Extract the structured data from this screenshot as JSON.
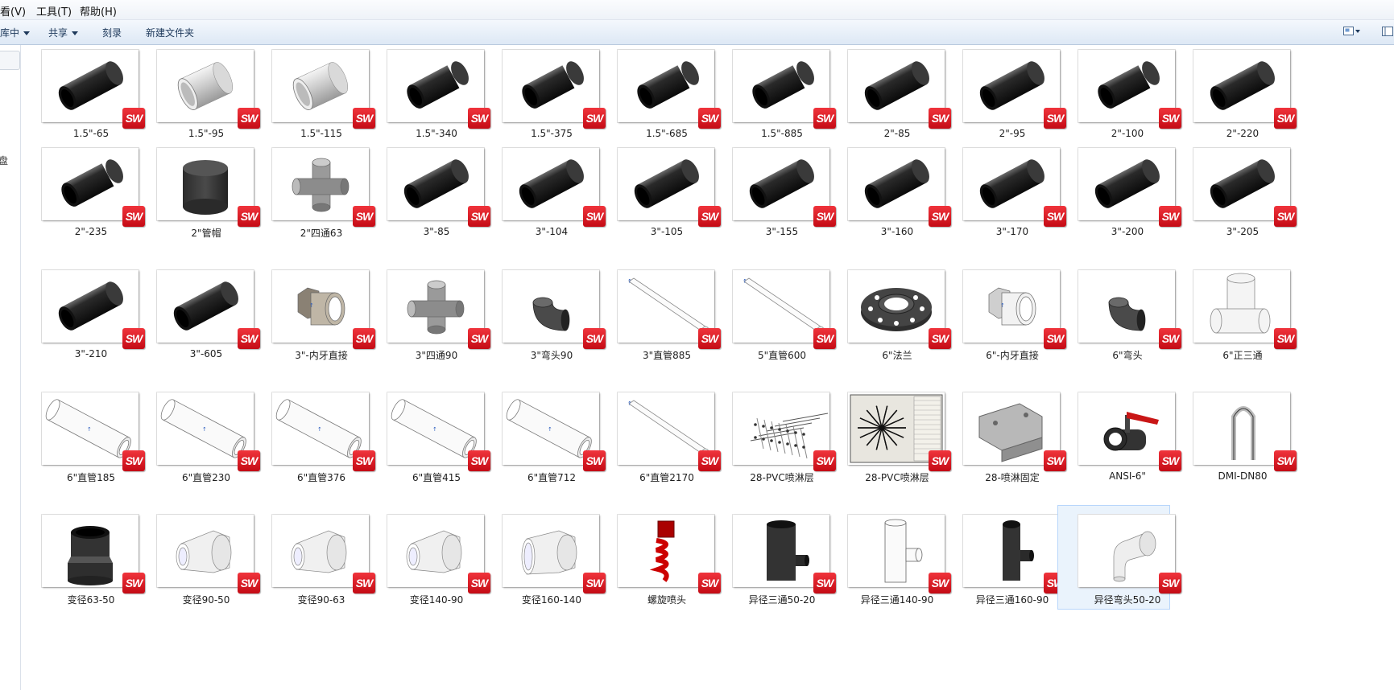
{
  "menu": {
    "view": "看(V)",
    "tools": "工具(T)",
    "help": "帮助(H)"
  },
  "toolbar": {
    "include_in_library": "库中",
    "share": "共享",
    "burn": "刻录",
    "new_folder": "新建文件夹"
  },
  "nav_pane": {
    "partial_label": "盘"
  },
  "badge_text": "SW",
  "colors": {
    "sw_badge": "#d3141d",
    "toolbar_text": "#1e395b",
    "selection_bg": "#eaf3fc"
  },
  "files": [
    {
      "name": "1.5\"-65",
      "icon": "black-pipe"
    },
    {
      "name": "1.5\"-95",
      "icon": "silver-coupling"
    },
    {
      "name": "1.5\"-115",
      "icon": "silver-coupling"
    },
    {
      "name": "1.5\"-340",
      "icon": "black-pipe-short"
    },
    {
      "name": "1.5\"-375",
      "icon": "black-pipe-short"
    },
    {
      "name": "1.5\"-685",
      "icon": "black-pipe-short"
    },
    {
      "name": "1.5\"-885",
      "icon": "black-pipe-short"
    },
    {
      "name": "2\"-85",
      "icon": "black-pipe"
    },
    {
      "name": "2\"-95",
      "icon": "black-pipe"
    },
    {
      "name": "2\"-100",
      "icon": "black-pipe-short"
    },
    {
      "name": "2\"-220",
      "icon": "black-pipe"
    },
    {
      "name": "2\"-235",
      "icon": "black-pipe-short"
    },
    {
      "name": "2\"管帽",
      "icon": "pipe-cap"
    },
    {
      "name": "2\"四通63",
      "icon": "cross-fitting"
    },
    {
      "name": "3\"-85",
      "icon": "black-pipe"
    },
    {
      "name": "3\"-104",
      "icon": "black-pipe"
    },
    {
      "name": "3\"-105",
      "icon": "black-pipe"
    },
    {
      "name": "3\"-155",
      "icon": "black-pipe"
    },
    {
      "name": "3\"-160",
      "icon": "black-pipe"
    },
    {
      "name": "3\"-170",
      "icon": "black-pipe"
    },
    {
      "name": "3\"-200",
      "icon": "black-pipe"
    },
    {
      "name": "3\"-205",
      "icon": "black-pipe"
    },
    {
      "name": "3\"-210",
      "icon": "black-pipe"
    },
    {
      "name": "3\"-605",
      "icon": "black-pipe"
    },
    {
      "name": "3\"-内牙直接",
      "icon": "threaded-adapter"
    },
    {
      "name": "3\"四通90",
      "icon": "cross-fitting"
    },
    {
      "name": "3\"弯头90",
      "icon": "elbow-dark"
    },
    {
      "name": "3\"直管885",
      "icon": "thin-white-pipe"
    },
    {
      "name": "5\"直管600",
      "icon": "thin-white-pipe"
    },
    {
      "name": "6\"法兰",
      "icon": "flange"
    },
    {
      "name": "6\"-内牙直接",
      "icon": "white-threaded-adapter"
    },
    {
      "name": "6\"弯头",
      "icon": "elbow-dark"
    },
    {
      "name": "6\"正三通",
      "icon": "white-tee"
    },
    {
      "name": "6\"直管185",
      "icon": "white-pipe"
    },
    {
      "name": "6\"直管230",
      "icon": "white-pipe"
    },
    {
      "name": "6\"直管376",
      "icon": "white-pipe"
    },
    {
      "name": "6\"直管415",
      "icon": "white-pipe"
    },
    {
      "name": "6\"直管712",
      "icon": "white-pipe"
    },
    {
      "name": "6\"直管2170",
      "icon": "thin-white-pipe"
    },
    {
      "name": "28-PVC喷淋层",
      "icon": "sprinkler-grid"
    },
    {
      "name": "28-PVC喷淋层",
      "icon": "drawing-sheet"
    },
    {
      "name": "28-喷淋固定",
      "icon": "bracket"
    },
    {
      "name": "ANSI-6\"",
      "icon": "valve"
    },
    {
      "name": "DMI-DN80",
      "icon": "u-bolt"
    },
    {
      "name": "变径63-50",
      "icon": "dark-reducer"
    },
    {
      "name": "变径90-50",
      "icon": "white-reducer"
    },
    {
      "name": "变径90-63",
      "icon": "white-reducer"
    },
    {
      "name": "变径140-90",
      "icon": "white-reducer"
    },
    {
      "name": "变径160-140",
      "icon": "white-reducer-large"
    },
    {
      "name": "螺旋喷头",
      "icon": "spiral-nozzle"
    },
    {
      "name": "异径三通50-20",
      "icon": "dark-tee"
    },
    {
      "name": "异径三通140-90",
      "icon": "white-tee-outline"
    },
    {
      "name": "异径三通160-90",
      "icon": "dark-tee-small"
    },
    {
      "name": "异径弯头50-20",
      "icon": "white-elbow-reducer"
    }
  ],
  "selected_file": "异径弯头50-20"
}
